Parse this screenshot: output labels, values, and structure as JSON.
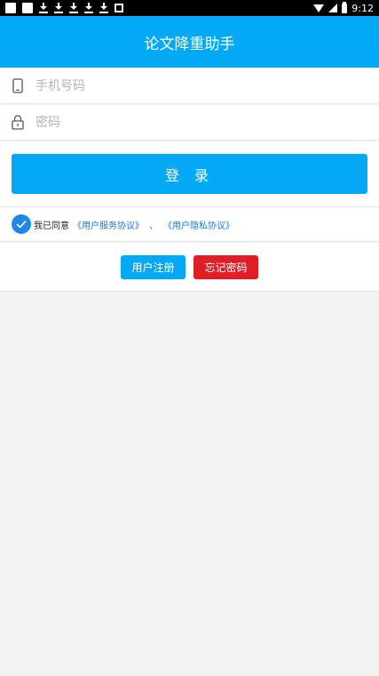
{
  "status_bar": {
    "time": "9:12"
  },
  "header": {
    "title": "论文降重助手"
  },
  "form": {
    "phone_placeholder": "手机号码",
    "password_placeholder": "密码",
    "login_label": "登 录"
  },
  "agreement": {
    "text": "我已同意",
    "service_link": "《用户服务协议》",
    "separator": "、",
    "privacy_link": "《用户隐私协议》",
    "checked": true
  },
  "actions": {
    "register_label": "用户注册",
    "forgot_label": "忘记密码"
  },
  "colors": {
    "primary": "#03a9f4",
    "danger": "#e01e25",
    "link": "#1976d2"
  }
}
